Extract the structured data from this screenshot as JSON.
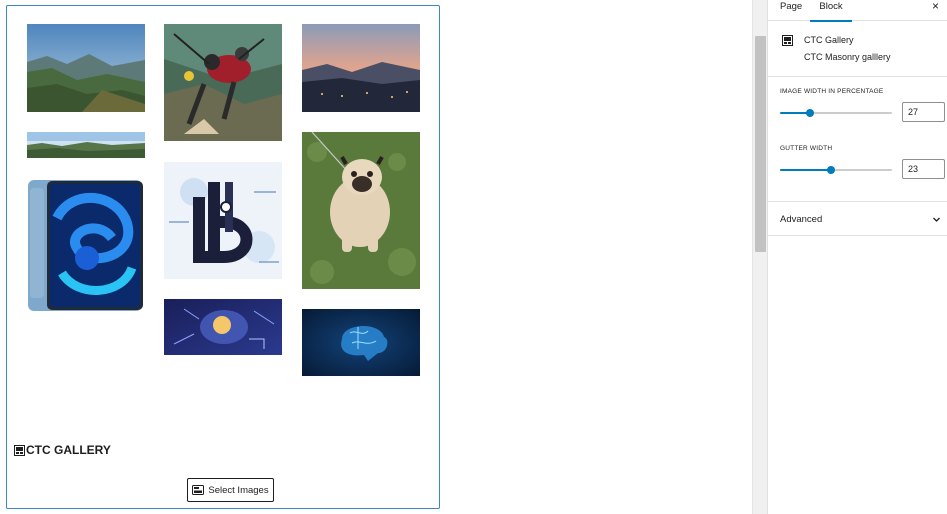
{
  "gallery": {
    "title": "CTC GALLERY",
    "select_button_label": "Select Images",
    "images": [
      {
        "name": "mountain-valley-image",
        "icon": "mountain-landscape"
      },
      {
        "name": "paragliding-image",
        "icon": "paragliding"
      },
      {
        "name": "sunset-hills-image",
        "icon": "sunset"
      },
      {
        "name": "panorama-image",
        "icon": "panorama"
      },
      {
        "name": "ipad-image",
        "icon": "tablet"
      },
      {
        "name": "letter-b-image",
        "icon": "letter-art"
      },
      {
        "name": "pug-dog-image",
        "icon": "dog"
      },
      {
        "name": "robot-brain-image",
        "icon": "ai-brain"
      },
      {
        "name": "blue-brain-image",
        "icon": "brain"
      }
    ]
  },
  "sidebar": {
    "tabs": [
      {
        "label": "Page",
        "active": false
      },
      {
        "label": "Block",
        "active": true
      }
    ],
    "close_label": "×",
    "block_card": {
      "title": "CTC Gallery",
      "description": "CTC Masonry galllery"
    },
    "settings": {
      "image_width": {
        "label": "Image width in percentage",
        "value": "27",
        "percent": 27
      },
      "gutter_width": {
        "label": "Gutter width",
        "value": "23",
        "percent": 46
      }
    },
    "advanced_label": "Advanced"
  },
  "colors": {
    "accent": "#007cba",
    "block_border": "#3a86c8"
  }
}
